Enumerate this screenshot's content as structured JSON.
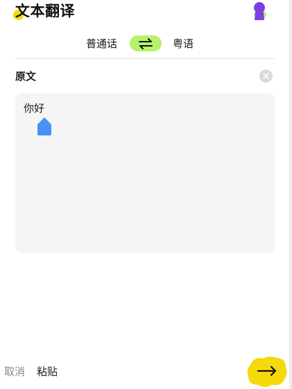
{
  "header": {
    "title": "文本翻译",
    "avatar_icon": "user-avatar-icon"
  },
  "language_bar": {
    "source_language": "普通话",
    "target_language": "粤语",
    "swap_icon": "swap-arrows-icon",
    "swap_color": "#b7f26b"
  },
  "source_section": {
    "label": "原文",
    "clear_icon": "close-circle-icon",
    "input_value": "你好",
    "cursor_handle_color": "#4a90f7"
  },
  "bottom_bar": {
    "cancel_label": "取消",
    "paste_label": "粘贴",
    "translate_icon": "arrow-right-icon",
    "accent_color": "#f5d90a"
  }
}
